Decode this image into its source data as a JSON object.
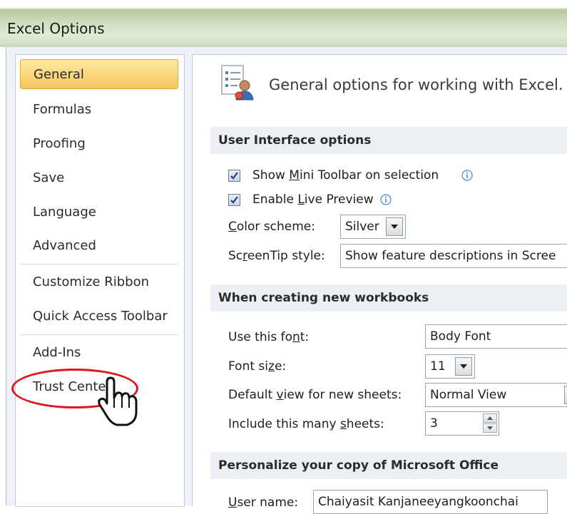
{
  "window": {
    "title": "Excel Options"
  },
  "nav": {
    "items": [
      {
        "label": "General",
        "selected": true
      },
      {
        "label": "Formulas"
      },
      {
        "label": "Proofing"
      },
      {
        "label": "Save"
      },
      {
        "label": "Language"
      },
      {
        "label": "Advanced"
      },
      {
        "label": "Customize Ribbon"
      },
      {
        "label": "Quick Access Toolbar"
      },
      {
        "label": "Add-Ins"
      },
      {
        "label": "Trust Center"
      }
    ]
  },
  "main": {
    "header": "General options for working with Excel.",
    "header_icon": "general-options-icon",
    "ui_section": {
      "title": "User Interface options",
      "mini_toolbar": {
        "label_pre": "Show ",
        "label_u": "M",
        "label_post": "ini Toolbar on selection",
        "checked": true
      },
      "live_preview": {
        "label_pre": "Enable ",
        "label_u": "L",
        "label_post": "ive Preview",
        "checked": true
      },
      "color_scheme": {
        "label_u": "C",
        "label_post": "olor scheme:",
        "value": "Silver"
      },
      "screentip": {
        "label_pre": "Sc",
        "label_u": "r",
        "label_post": "eenTip style:",
        "value": "Show feature descriptions in Scree"
      }
    },
    "workbook_section": {
      "title": "When creating new workbooks",
      "font": {
        "label_pre": "Use this fo",
        "label_u": "n",
        "label_post": "t:",
        "value": "Body Font"
      },
      "font_size": {
        "label_pre": "Font si",
        "label_u": "z",
        "label_post": "e:",
        "value": "11"
      },
      "default_view": {
        "label_pre": "Default ",
        "label_u": "v",
        "label_post": "iew for new sheets:",
        "value": "Normal View"
      },
      "sheets": {
        "label_pre": "Include this many ",
        "label_u": "s",
        "label_post": "heets:",
        "value": "3"
      }
    },
    "personalize_section": {
      "title": "Personalize your copy of Microsoft Office",
      "user_name": {
        "label_pre": "",
        "label_u": "U",
        "label_post": "ser name:",
        "value": "Chaiyasit Kanjaneeyangkoonchai"
      }
    }
  },
  "colors": {
    "selected_nav": "#fbd97e",
    "annotation": "#e0141c",
    "section_bg": "#eceff3"
  }
}
